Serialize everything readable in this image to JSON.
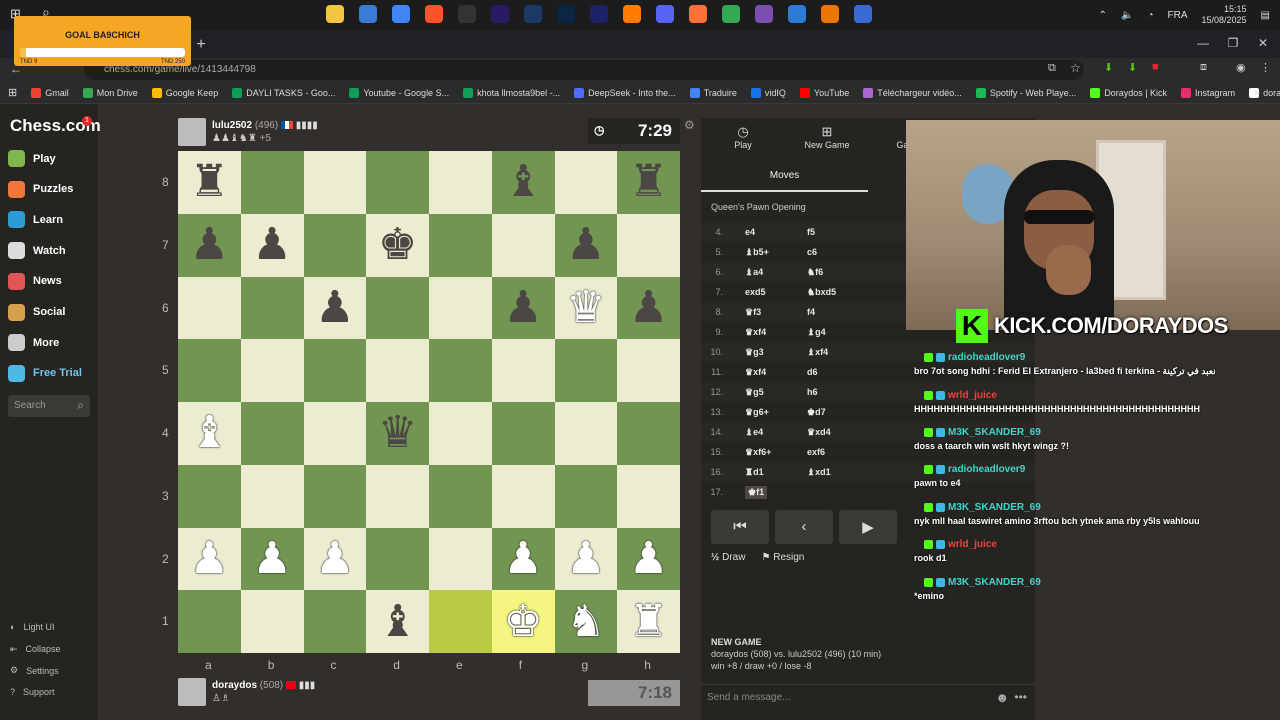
{
  "taskbar": {
    "lang": "FRA",
    "time": "15:15",
    "date": "15/08/2025",
    "app_icons": [
      "folder-icon",
      "store-icon",
      "chrome-icon",
      "brave-icon",
      "obs-icon",
      "premiere-icon",
      "audition-icon",
      "photoshop-icon",
      "after-effects-icon",
      "illustrator-icon",
      "discord-icon",
      "firefox-icon",
      "chrome2-icon",
      "vsc-icon",
      "app-icon",
      "blender-icon",
      "app2-icon"
    ]
  },
  "goal": {
    "title": "GOAL BA9CHICH",
    "left_label": "TND 9",
    "right_label": "TND 250",
    "progress": 0.036
  },
  "browser": {
    "url": "chess.com/game/live/1413444798",
    "bookmarks": [
      {
        "label": "Gmail",
        "color": "#ea4335"
      },
      {
        "label": "Mon Drive",
        "color": "#34a853"
      },
      {
        "label": "Google Keep",
        "color": "#fbbc04"
      },
      {
        "label": "DAYLI TASKS - Goo...",
        "color": "#0f9d58"
      },
      {
        "label": "Youtube - Google S...",
        "color": "#0f9d58"
      },
      {
        "label": "khota llmosta9bel -...",
        "color": "#0f9d58"
      },
      {
        "label": "DeepSeek - Into the...",
        "color": "#4d6bfe"
      },
      {
        "label": "Traduire",
        "color": "#4285f4"
      },
      {
        "label": "vidIQ",
        "color": "#1a73e8"
      },
      {
        "label": "YouTube",
        "color": "#ff0000"
      },
      {
        "label": "Téléchargeur vidéo...",
        "color": "#aa66cc"
      },
      {
        "label": "Spotify - Web Playe...",
        "color": "#1db954"
      },
      {
        "label": "Doraydos | Kick",
        "color": "#53fc18"
      },
      {
        "label": "Instagram",
        "color": "#e1306c"
      },
      {
        "label": "doraydos.off (@dor...",
        "color": "#ffffff"
      }
    ]
  },
  "nav": {
    "logo": "Chess.com",
    "logo_badge": "1",
    "items": [
      {
        "label": "Play",
        "icon": "play-icon",
        "color": "#81b64c"
      },
      {
        "label": "Puzzles",
        "icon": "puzzles-icon",
        "color": "#f0763a"
      },
      {
        "label": "Learn",
        "icon": "learn-icon",
        "color": "#2d9bd6"
      },
      {
        "label": "Watch",
        "icon": "watch-icon",
        "color": "#dddddd"
      },
      {
        "label": "News",
        "icon": "news-icon",
        "color": "#e05555"
      },
      {
        "label": "Social",
        "icon": "social-icon",
        "color": "#d6a14c"
      },
      {
        "label": "More",
        "icon": "more-icon",
        "color": "#cccccc"
      },
      {
        "label": "Free Trial",
        "icon": "diamond-icon",
        "color": "#4fb8e6"
      }
    ],
    "search_placeholder": "Search",
    "bottom": [
      "Light UI",
      "Collapse",
      "Settings",
      "Support"
    ]
  },
  "top_player": {
    "name": "lulu2502",
    "rating": "(496)",
    "flag_colors": [
      "#0055a4",
      "#ffffff",
      "#ef4135"
    ],
    "captured": "♟♟♝♞♜",
    "advantage": "+5",
    "clock": "7:29"
  },
  "bottom_player": {
    "name": "doraydos",
    "rating": "(508)",
    "captured": "♙♗",
    "clock": "7:18"
  },
  "board": {
    "ranks": [
      "8",
      "7",
      "6",
      "5",
      "4",
      "3",
      "2",
      "1"
    ],
    "files": [
      "a",
      "b",
      "c",
      "d",
      "e",
      "f",
      "g",
      "h"
    ],
    "position": [
      [
        "br",
        "",
        "",
        "",
        "",
        "bb",
        "",
        "br"
      ],
      [
        "bp",
        "bp",
        "",
        "bk",
        "",
        "",
        "bp",
        ""
      ],
      [
        "",
        "",
        "bp",
        "",
        "",
        "bp",
        "wq",
        "bp"
      ],
      [
        "",
        "",
        "",
        "",
        "",
        "",
        "",
        ""
      ],
      [
        "wb",
        "",
        "",
        "bq",
        "",
        "",
        "",
        ""
      ],
      [
        "",
        "",
        "",
        "",
        "",
        "",
        "",
        ""
      ],
      [
        "wp",
        "wp",
        "wp",
        "",
        "",
        "wp",
        "wp",
        "wp"
      ],
      [
        "",
        "",
        "",
        "bb",
        "",
        "wk",
        "wn",
        "wr"
      ]
    ],
    "highlight": [
      [
        7,
        4
      ],
      [
        7,
        5
      ]
    ]
  },
  "panel": {
    "tabs": [
      "Play",
      "New Game",
      "Games"
    ],
    "moves_tab": "Moves",
    "opening": "Queen's Pawn Opening",
    "moves": [
      {
        "n": "4.",
        "w": "e4",
        "b": "f5"
      },
      {
        "n": "5.",
        "w": "♝b5+",
        "b": "c6"
      },
      {
        "n": "6.",
        "w": "♝a4",
        "b": "♞f6"
      },
      {
        "n": "7.",
        "w": "exd5",
        "b": "♞bxd5"
      },
      {
        "n": "8.",
        "w": "♛f3",
        "b": "f4"
      },
      {
        "n": "9.",
        "w": "♛xf4",
        "b": "♝g4"
      },
      {
        "n": "10.",
        "w": "♛g3",
        "b": "♝xf4"
      },
      {
        "n": "11.",
        "w": "♛xf4",
        "b": "d6"
      },
      {
        "n": "12.",
        "w": "♛g5",
        "b": "h6"
      },
      {
        "n": "13.",
        "w": "♛g6+",
        "b": "♚d7"
      },
      {
        "n": "14.",
        "w": "♝e4",
        "b": "♛xd4"
      },
      {
        "n": "15.",
        "w": "♛xf6+",
        "b": "exf6"
      },
      {
        "n": "16.",
        "w": "♜d1",
        "b": "♝xd1"
      },
      {
        "n": "17.",
        "w": "♚f1",
        "b": ""
      }
    ],
    "draw": "Draw",
    "resign": "Resign",
    "new_game_title": "NEW GAME",
    "new_game_line1": "doraydos (508) vs. lulu2502 (496) (10 min)",
    "new_game_line2": "win +8 / draw +0 / lose -8",
    "message_placeholder": "Send a message..."
  },
  "stream": {
    "kick_url": "KICK.COM/DORAYDOS",
    "chat": [
      {
        "user": "radioheadlover9",
        "color": "#3fd6c8",
        "text": "bro 7ot song hdhi : Ferid El Extranjero - la3bed fi terkina - نعبد في تركينة"
      },
      {
        "user": "wrld_juice",
        "color": "#e8453c",
        "text": "HHHHHHHHHHHHHHHHHHHHHHHHHHHHHHHHHHHHHHHHHHHH"
      },
      {
        "user": "M3K_SKANDER_69",
        "color": "#3fd6c8",
        "text": "doss a taarch win wslt hkyt wingz ?!"
      },
      {
        "user": "radioheadlover9",
        "color": "#3fd6c8",
        "text": "pawn to e4"
      },
      {
        "user": "M3K_SKANDER_69",
        "color": "#3fd6c8",
        "text": "nyk mll haal taswiret amino 3rftou bch ytnek ama rby y5ls wahlouu"
      },
      {
        "user": "wrld_juice",
        "color": "#e8453c",
        "text": "rook d1"
      },
      {
        "user": "M3K_SKANDER_69",
        "color": "#3fd6c8",
        "text": "*emino"
      }
    ]
  }
}
